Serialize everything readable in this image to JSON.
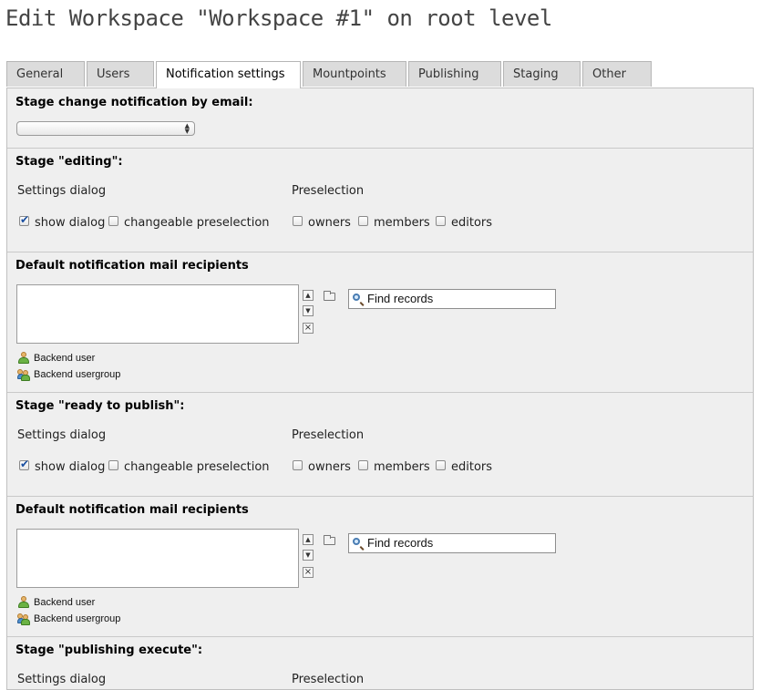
{
  "page_title": "Edit Workspace \"Workspace #1\" on root level",
  "tabs": [
    {
      "label": "General"
    },
    {
      "label": "Users"
    },
    {
      "label": "Notification settings"
    },
    {
      "label": "Mountpoints"
    },
    {
      "label": "Publishing"
    },
    {
      "label": "Staging"
    },
    {
      "label": "Other"
    }
  ],
  "active_tab": "Notification settings",
  "notification": {
    "title": "Stage change notification by email:",
    "select_value": ""
  },
  "stage_editing": {
    "title": "Stage \"editing\":",
    "settings_dialog_label": "Settings dialog",
    "preselection_label": "Preselection",
    "show_dialog": {
      "label": "show dialog",
      "checked": true
    },
    "changeable_preselection": {
      "label": "changeable preselection",
      "checked": false
    },
    "owners": {
      "label": "owners",
      "checked": false
    },
    "members": {
      "label": "members",
      "checked": false
    },
    "editors": {
      "label": "editors",
      "checked": false
    }
  },
  "recipients_1": {
    "title": "Default notification mail recipients",
    "find_placeholder": "Find records",
    "legend_user": "Backend user",
    "legend_group": "Backend usergroup"
  },
  "stage_ready": {
    "title": "Stage \"ready to publish\":",
    "settings_dialog_label": "Settings dialog",
    "preselection_label": "Preselection",
    "show_dialog": {
      "label": "show dialog",
      "checked": true
    },
    "changeable_preselection": {
      "label": "changeable preselection",
      "checked": false
    },
    "owners": {
      "label": "owners",
      "checked": false
    },
    "members": {
      "label": "members",
      "checked": false
    },
    "editors": {
      "label": "editors",
      "checked": false
    }
  },
  "recipients_2": {
    "title": "Default notification mail recipients",
    "find_placeholder": "Find records",
    "legend_user": "Backend user",
    "legend_group": "Backend usergroup"
  },
  "stage_publishing": {
    "title": "Stage \"publishing execute\":",
    "settings_dialog_label": "Settings dialog",
    "preselection_label": "Preselection"
  }
}
